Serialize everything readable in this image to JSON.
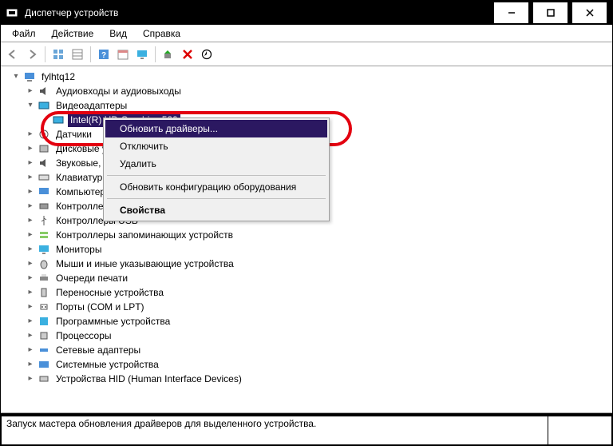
{
  "title": "Диспетчер устройств",
  "menu": {
    "file": "Файл",
    "action": "Действие",
    "view": "Вид",
    "help": "Справка"
  },
  "tree": {
    "root": "fylhtq12",
    "audio": "Аудиовходы и аудиовыходы",
    "video": "Видеоадаптеры",
    "video_device": "Intel(R) HD Graphics 520",
    "sensors": "Датчики",
    "disks": "Дисковые устройства",
    "sound": "Звуковые, игровые и видеоустройства",
    "keyboards": "Клавиатуры",
    "computer": "Компьютер",
    "controllers_ide": "Контроллеры IDE ATA/ATAPI",
    "controllers_usb": "Контроллеры USB",
    "controllers_storage": "Контроллеры запоминающих устройств",
    "monitors": "Мониторы",
    "mice": "Мыши и иные указывающие устройства",
    "print_queues": "Очереди печати",
    "portable": "Переносные устройства",
    "ports": "Порты (COM и LPT)",
    "software": "Программные устройства",
    "processors": "Процессоры",
    "network": "Сетевые адаптеры",
    "system": "Системные устройства",
    "hid": "Устройства HID (Human Interface Devices)"
  },
  "context_menu": {
    "update": "Обновить драйверы...",
    "disable": "Отключить",
    "delete": "Удалить",
    "scan": "Обновить конфигурацию оборудования",
    "properties": "Свойства"
  },
  "statusbar": "Запуск мастера обновления драйверов для выделенного устройства."
}
